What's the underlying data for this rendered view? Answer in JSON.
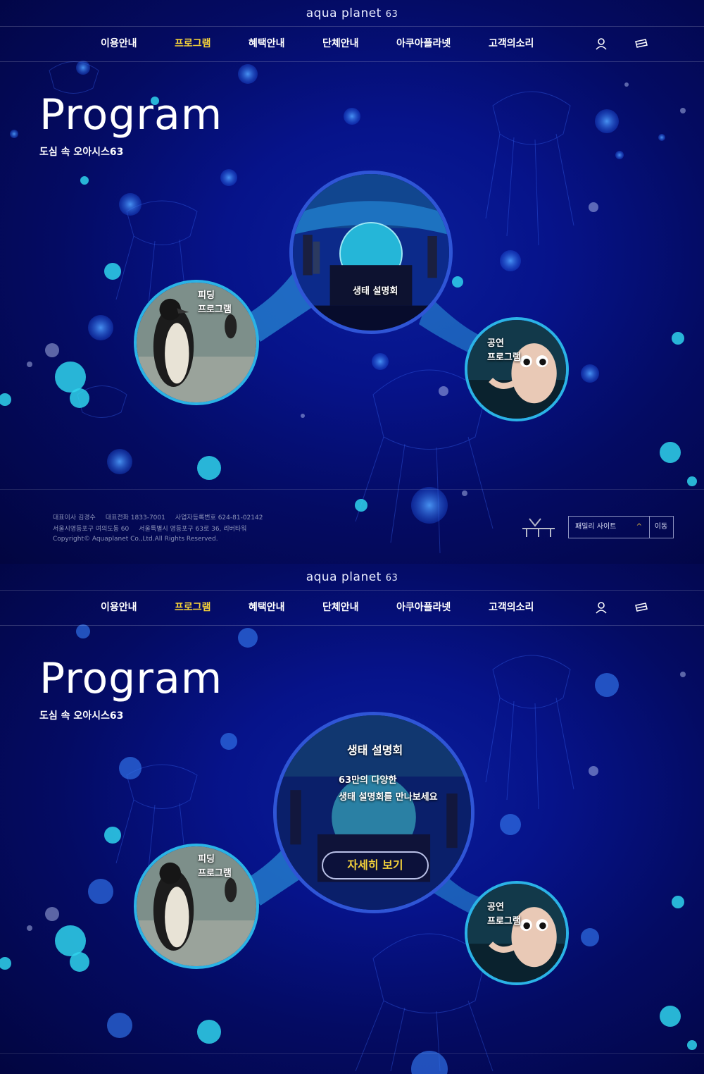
{
  "brand": {
    "name": "aqua planet",
    "number": "63"
  },
  "nav": {
    "items": [
      {
        "label": "이용안내",
        "active": false
      },
      {
        "label": "프로그램",
        "active": true
      },
      {
        "label": "혜택안내",
        "active": false
      },
      {
        "label": "단체안내",
        "active": false
      },
      {
        "label": "아쿠아플라넷",
        "active": false
      },
      {
        "label": "고객의소리",
        "active": false
      }
    ],
    "icons": [
      "user-icon",
      "ticket-icon"
    ]
  },
  "hero": {
    "title": "Program",
    "subtitle": "도심 속 오아시스63"
  },
  "programs": {
    "center": {
      "label": "생태 설명회"
    },
    "feeding": {
      "line1": "피딩",
      "line2": "프로그램"
    },
    "show": {
      "line1": "공연",
      "line2": "프로그램"
    }
  },
  "hover": {
    "title": "생태 설명회",
    "desc1": "63만의 다양한",
    "desc2": "생태 설명회를 만나보세요",
    "button": "자세히 보기"
  },
  "footer": {
    "ceo": "대표이사 김경수",
    "phone": "대표전화 1833-7001",
    "biz": "사업자등록번호 624-81-02142",
    "addr1": "서울시영등포구 여의도동 60",
    "addr2": "서울특별시 영등포구 63로 36, 리버타워",
    "copyright": "Copyright© Aquaplanet Co.,Ltd.All Rights Reserved.",
    "family_label": "패밀리 사이트",
    "go_label": "이동"
  },
  "colors": {
    "accent": "#f5d23a",
    "background": "#06138a",
    "glow": "#2fd3ec"
  }
}
